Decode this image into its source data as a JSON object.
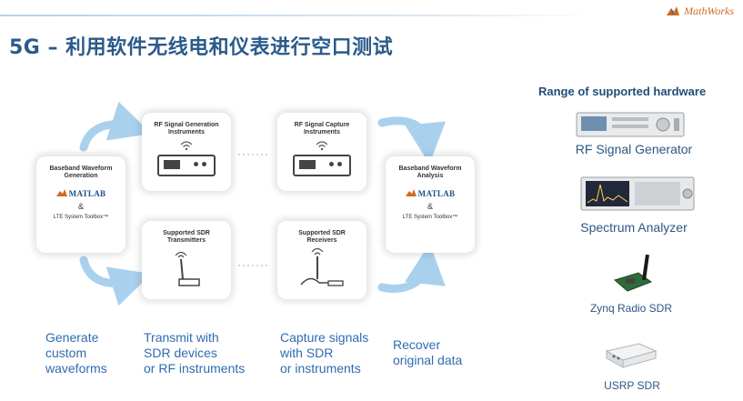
{
  "brand": {
    "name": "MathWorks"
  },
  "title": "5G – 利用软件无线电和仪表进行空口测试",
  "flow": {
    "generation_card": {
      "title": "Baseband Waveform\nGeneration",
      "matlab": "MATLAB",
      "amp": "&",
      "toolbox": "LTE System Toolbox™"
    },
    "rf_gen_card": {
      "title": "RF Signal Generation\nInstruments"
    },
    "sdr_tx_card": {
      "title": "Supported SDR\nTransmitters"
    },
    "rf_cap_card": {
      "title": "RF Signal Capture\nInstruments"
    },
    "sdr_rx_card": {
      "title": "Supported SDR\nReceivers"
    },
    "analysis_card": {
      "title": "Baseband Waveform\nAnalysis",
      "matlab": "MATLAB",
      "amp": "&",
      "toolbox": "LTE System Toolbox™"
    }
  },
  "captions": [
    "Generate\ncustom\nwaveforms",
    "Transmit with\nSDR devices\nor RF instruments",
    "Capture signals\nwith SDR\nor instruments",
    "Recover\noriginal data"
  ],
  "hardware": {
    "heading": "Range of supported hardware",
    "items": [
      {
        "label": "RF Signal Generator",
        "icon": "signal-generator"
      },
      {
        "label": "Spectrum Analyzer",
        "icon": "spectrum-analyzer"
      },
      {
        "label": "Zynq Radio SDR",
        "icon": "zynq-board"
      },
      {
        "label": "USRP SDR",
        "icon": "usrp-device"
      }
    ]
  },
  "colors": {
    "title": "#2b5a8a",
    "caption": "#2f6cb0",
    "arrow": "#a9d1ee",
    "brand": "#d2691e"
  }
}
